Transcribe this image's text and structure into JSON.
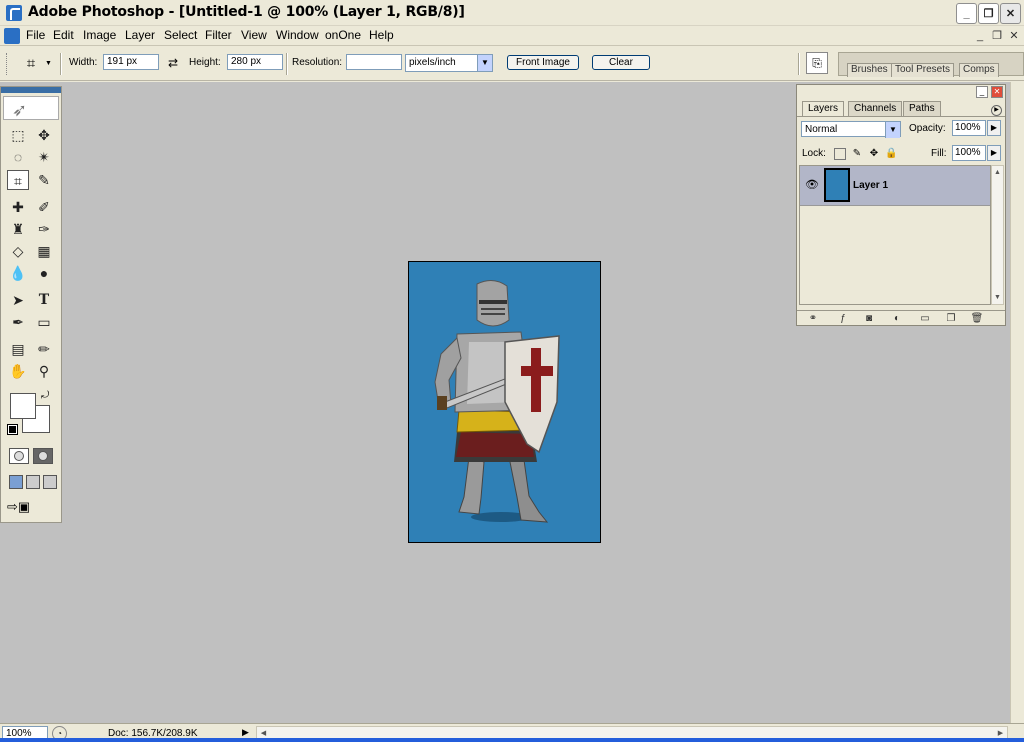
{
  "window": {
    "title": "Adobe Photoshop - [Untitled-1 @ 100% (Layer 1, RGB/8)]",
    "minimize": "_",
    "maximize": "❐",
    "close": "✕"
  },
  "menu": {
    "items": [
      "File",
      "Edit",
      "Image",
      "Layer",
      "Select",
      "Filter",
      "View",
      "Window",
      "onOne",
      "Help"
    ],
    "doc_minimize": "_",
    "doc_restore": "❐",
    "doc_close": "✕"
  },
  "options": {
    "width_label": "Width:",
    "width_value": "191 px",
    "height_label": "Height:",
    "height_value": "280 px",
    "resolution_label": "Resolution:",
    "resolution_value": "",
    "resolution_unit": "pixels/inch",
    "front_image_label": "Front Image",
    "clear_label": "Clear"
  },
  "palette_well": {
    "tabs": [
      "Brushes",
      "Tool Presets",
      "Comps"
    ]
  },
  "layers_panel": {
    "tabs": [
      "Layers",
      "Channels",
      "Paths"
    ],
    "active_tab": "Layers",
    "blend_mode": "Normal",
    "opacity_label": "Opacity:",
    "opacity_value": "100%",
    "lock_label": "Lock:",
    "fill_label": "Fill:",
    "fill_value": "100%",
    "layers": [
      {
        "name": "Layer 1",
        "visible": true,
        "selected": true
      }
    ]
  },
  "canvas": {
    "background_color": "#2F80B6"
  },
  "status": {
    "zoom": "100%",
    "doc_info": "Doc: 156.7K/208.9K"
  },
  "colors": {
    "workspace": "#C0C0C0",
    "chrome": "#ECE9D8",
    "layer_selected": "#B2B6C8"
  }
}
